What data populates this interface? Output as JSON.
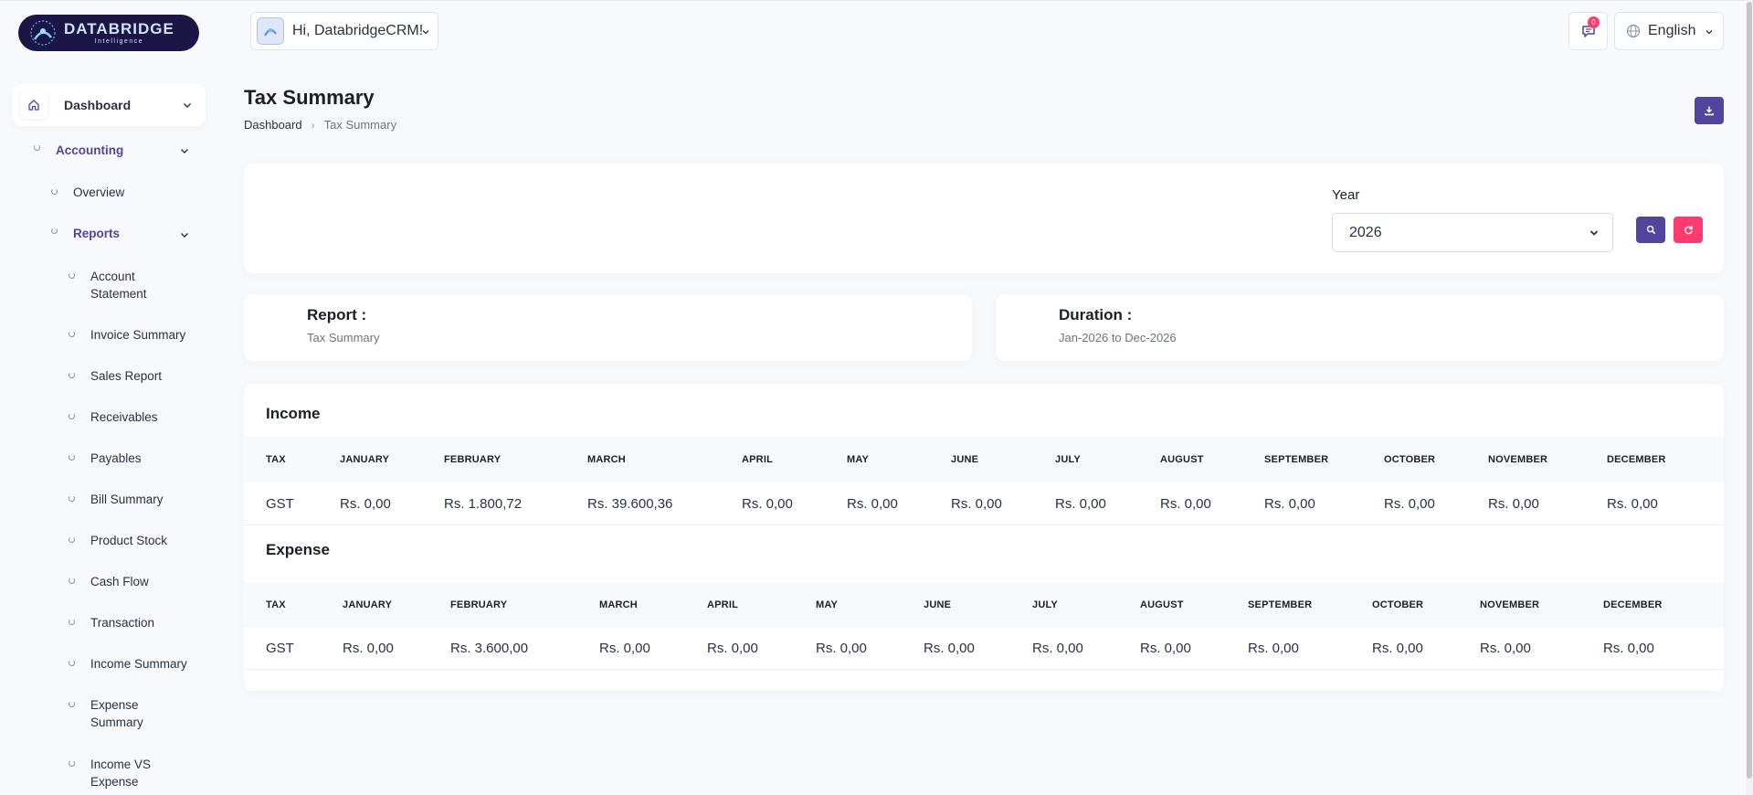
{
  "brand": {
    "name": "DATABRIDGE",
    "tagline": "Intelligence"
  },
  "header": {
    "greeting": "Hi, DatabridgeCRM!",
    "notification_count": "0",
    "language": "English"
  },
  "sidebar": {
    "dashboard": "Dashboard",
    "accounting": "Accounting",
    "overview": "Overview",
    "reports": "Reports",
    "report_items": [
      "Account Statement",
      "Invoice Summary",
      "Sales Report",
      "Receivables",
      "Payables",
      "Bill Summary",
      "Product Stock",
      "Cash Flow",
      "Transaction",
      "Income Summary",
      "Expense Summary",
      "Income VS Expense"
    ]
  },
  "page": {
    "title": "Tax Summary",
    "breadcrumb": {
      "home": "Dashboard",
      "current": "Tax Summary"
    }
  },
  "filter": {
    "year_label": "Year",
    "year_value": "2026"
  },
  "info": {
    "report_label": "Report :",
    "report_value": "Tax Summary",
    "duration_label": "Duration :",
    "duration_value": "Jan-2026 to Dec-2026"
  },
  "columns": [
    "TAX",
    "JANUARY",
    "FEBRUARY",
    "MARCH",
    "APRIL",
    "MAY",
    "JUNE",
    "JULY",
    "AUGUST",
    "SEPTEMBER",
    "OCTOBER",
    "NOVEMBER",
    "DECEMBER"
  ],
  "income": {
    "title": "Income",
    "rows": [
      [
        "GST",
        "Rs. 0,00",
        "Rs. 1.800,72",
        "Rs. 39.600,36",
        "Rs. 0,00",
        "Rs. 0,00",
        "Rs. 0,00",
        "Rs. 0,00",
        "Rs. 0,00",
        "Rs. 0,00",
        "Rs. 0,00",
        "Rs. 0,00",
        "Rs. 0,00"
      ]
    ]
  },
  "expense": {
    "title": "Expense",
    "rows": [
      [
        "GST",
        "Rs. 0,00",
        "Rs. 3.600,00",
        "Rs. 0,00",
        "Rs. 0,00",
        "Rs. 0,00",
        "Rs. 0,00",
        "Rs. 0,00",
        "Rs. 0,00",
        "Rs. 0,00",
        "Rs. 0,00",
        "Rs. 0,00",
        "Rs. 0,00"
      ]
    ]
  },
  "colors": {
    "primary": "#51459d",
    "danger": "#ff3a6e",
    "background": "#f8f9fd"
  }
}
